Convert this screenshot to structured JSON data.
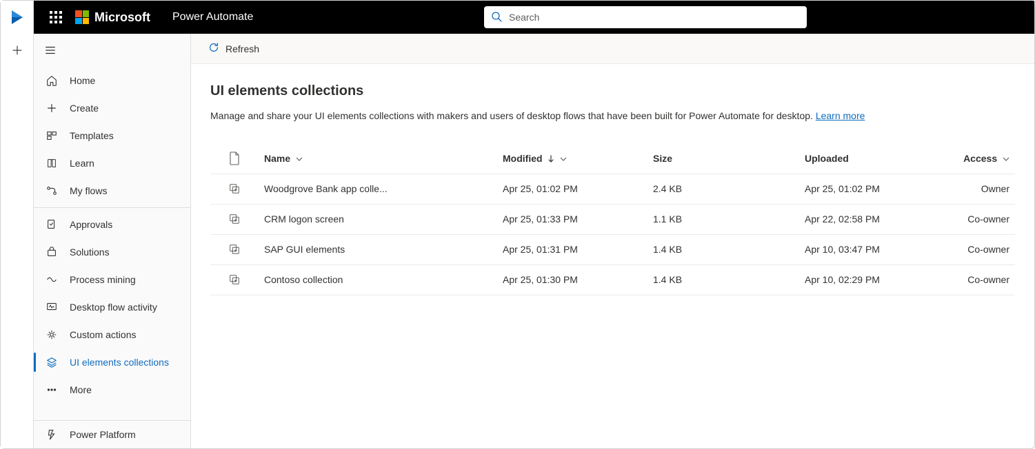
{
  "header": {
    "ms_word": "Microsoft",
    "app_title": "Power Automate"
  },
  "search": {
    "placeholder": "Search"
  },
  "commandbar": {
    "refresh_label": "Refresh"
  },
  "sidebar": {
    "items": [
      {
        "label": "Home"
      },
      {
        "label": "Create"
      },
      {
        "label": "Templates"
      },
      {
        "label": "Learn"
      },
      {
        "label": "My flows"
      },
      {
        "label": "Approvals"
      },
      {
        "label": "Solutions"
      },
      {
        "label": "Process mining"
      },
      {
        "label": "Desktop flow activity"
      },
      {
        "label": "Custom actions"
      },
      {
        "label": "UI elements collections"
      },
      {
        "label": "More"
      }
    ],
    "bottom": {
      "label": "Power Platform"
    }
  },
  "page": {
    "title": "UI elements collections",
    "description": "Manage and share your UI elements collections with makers and users of desktop flows that have been built for Power Automate for desktop. ",
    "learn_more": "Learn more"
  },
  "table": {
    "columns": {
      "name": "Name",
      "modified": "Modified",
      "size": "Size",
      "uploaded": "Uploaded",
      "access": "Access"
    },
    "rows": [
      {
        "name": "Woodgrove Bank app colle...",
        "modified": "Apr 25, 01:02 PM",
        "size": "2.4 KB",
        "uploaded": "Apr 25, 01:02 PM",
        "access": "Owner"
      },
      {
        "name": "CRM logon screen",
        "modified": "Apr 25, 01:33 PM",
        "size": "1.1 KB",
        "uploaded": "Apr 22, 02:58 PM",
        "access": "Co-owner"
      },
      {
        "name": "SAP GUI elements",
        "modified": "Apr 25, 01:31 PM",
        "size": "1.4 KB",
        "uploaded": "Apr 10, 03:47 PM",
        "access": "Co-owner"
      },
      {
        "name": "Contoso collection",
        "modified": "Apr 25, 01:30 PM",
        "size": "1.4 KB",
        "uploaded": "Apr 10, 02:29 PM",
        "access": "Co-owner"
      }
    ]
  }
}
